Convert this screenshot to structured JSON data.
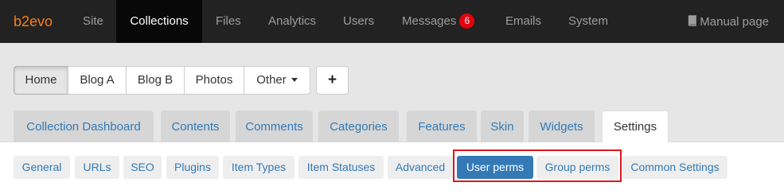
{
  "navbar": {
    "brand": "b2evo",
    "items": [
      {
        "label": "Site"
      },
      {
        "label": "Collections"
      },
      {
        "label": "Files"
      },
      {
        "label": "Analytics"
      },
      {
        "label": "Users"
      },
      {
        "label": "Messages",
        "badge": "6"
      },
      {
        "label": "Emails"
      },
      {
        "label": "System"
      }
    ],
    "active": "Collections",
    "manual_label": "Manual page",
    "manual_icon": "book-icon"
  },
  "collections": {
    "buttons": [
      "Home",
      "Blog A",
      "Blog B",
      "Photos",
      "Other"
    ],
    "active": "Home",
    "add_label": "+"
  },
  "tabs": {
    "items": [
      "Collection Dashboard",
      "Contents",
      "Comments",
      "Categories",
      "Features",
      "Skin",
      "Widgets",
      "Settings"
    ],
    "active": "Settings"
  },
  "subtabs": {
    "items": [
      "General",
      "URLs",
      "SEO",
      "Plugins",
      "Item Types",
      "Item Statuses",
      "Advanced",
      "User perms",
      "Group perms",
      "Common Settings"
    ],
    "active": "User perms"
  },
  "colors": {
    "brand": "#f57f17",
    "navbar_bg": "#222222",
    "link": "#337ab7",
    "active_pill": "#337ab7",
    "badge": "#e4000f",
    "highlight_box": "#e0161e"
  }
}
